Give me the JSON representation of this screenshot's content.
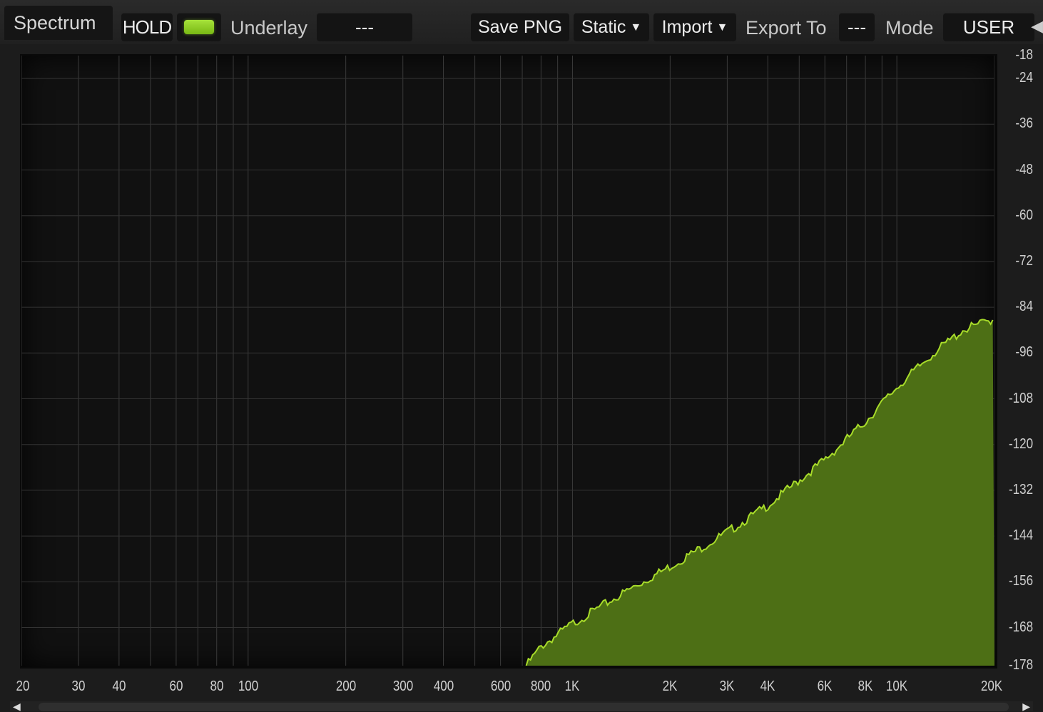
{
  "toolbar": {
    "tab_label": "Spectrum",
    "hold_label": "HOLD",
    "hold_led_color": "#8fd11f",
    "underlay_label": "Underlay",
    "underlay_value": "---",
    "save_png_label": "Save PNG",
    "static_label": "Static",
    "import_label": "Import",
    "export_label": "Export To",
    "export_value": "---",
    "mode_label": "Mode",
    "mode_value": "USER"
  },
  "chart_data": {
    "type": "area",
    "title": "",
    "xlabel": "",
    "ylabel": "",
    "xscale": "log",
    "xlim": [
      20,
      20000
    ],
    "ylim": [
      -178,
      -18
    ],
    "fill_color": "#4d6f15",
    "line_color": "#a8dc2a",
    "grid": true,
    "x_ticks": [
      "20",
      "30",
      "40",
      "60",
      "80",
      "100",
      "200",
      "300",
      "400",
      "600",
      "800",
      "1K",
      "2K",
      "3K",
      "4K",
      "6K",
      "8K",
      "10K",
      "20K"
    ],
    "y_ticks": [
      "-18",
      "-24",
      "-36",
      "-48",
      "-60",
      "-72",
      "-84",
      "-96",
      "-108",
      "-120",
      "-132",
      "-144",
      "-156",
      "-168",
      "-178"
    ],
    "series": [
      {
        "x": [
          720,
          800,
          1000,
          1500,
          2000,
          3000,
          4000,
          6000,
          8000,
          10000,
          13000,
          16000,
          20000
        ],
        "y": [
          -178,
          -173,
          -167,
          -158,
          -152,
          -143,
          -136,
          -124,
          -114,
          -105,
          -96,
          -90,
          -87
        ]
      }
    ]
  },
  "scroll": {
    "left_arrow": "◀",
    "right_arrow": "▶"
  },
  "edge_arrow": "◀"
}
